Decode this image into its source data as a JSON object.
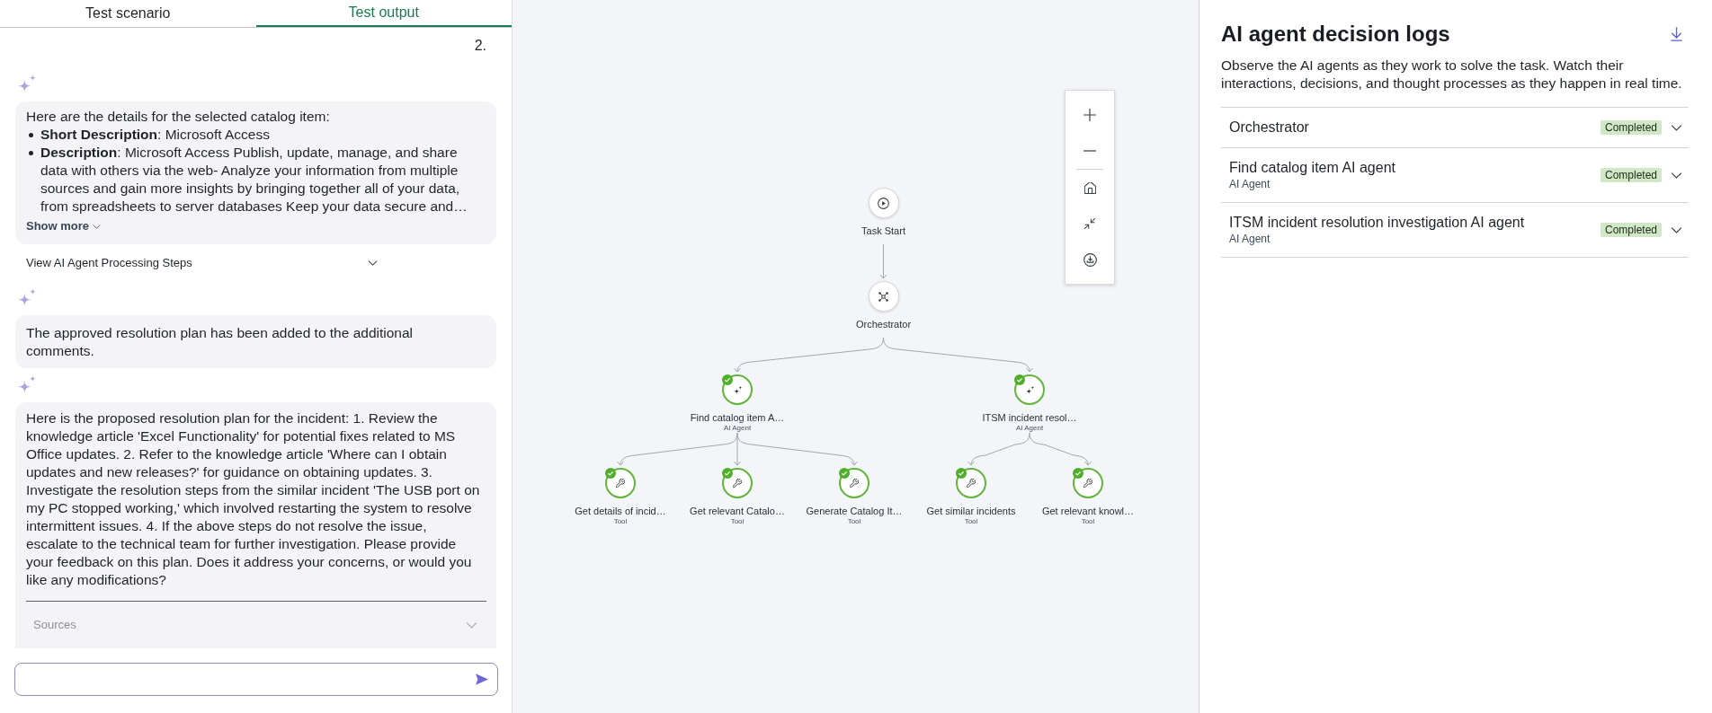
{
  "tabs": [
    {
      "label": "Test scenario",
      "selected": false
    },
    {
      "label": "Test output",
      "selected": true
    }
  ],
  "chat": {
    "partial_message": "2.",
    "messages": [
      {
        "kind": "details",
        "intro": "Here are the details for the selected catalog item:",
        "bullets": [
          "**Short Description**: Microsoft Access",
          "**Description**: Microsoft Access Publish, update, manage, and share data with others via the web- Analyze your information from multiple sources and gain more insights by bringing together all of your data, from spreadsheets to server databases Keep your data secure and…"
        ],
        "show_more": "Show more",
        "steps_toggle": {
          "label": "View AI Agent Processing Steps",
          "expanded": false
        }
      },
      {
        "kind": "text",
        "text": "The approved resolution plan has been added to the additional comments."
      },
      {
        "kind": "text",
        "text": "Here is the proposed resolution plan for the incident: 1. Review the knowledge article 'Excel Functionality' for potential fixes related to MS Office updates. 2. Refer to the knowledge article 'Where can I obtain updates and new releases?' for guidance on obtaining updates. 3. Investigate the resolution steps from the similar incident 'The USB port on my PC stopped working,' which involved restarting the system to resolve intermittent issues. 4. If the above steps do not resolve the issue, escalate to the technical team for further investigation. Please provide your feedback on this plan. Does it address your concerns, or would you like any modifications?",
        "sources": {
          "label": "Sources",
          "expanded": false
        }
      }
    ]
  },
  "flow": {
    "label": "Task Start",
    "kind": "start",
    "completed": false,
    "children": [
      {
        "label": "Orchestrator",
        "kind": "orchestrator",
        "completed": false,
        "children": [
          {
            "label": "Find catalog item A…",
            "type_label": "AI Agent",
            "kind": "agent",
            "completed": true,
            "children": [
              {
                "label": "Get details of incid…",
                "type_label": "Tool",
                "kind": "tool",
                "completed": true
              },
              {
                "label": "Get relevant Catalo…",
                "type_label": "Tool",
                "kind": "tool",
                "completed": true
              },
              {
                "label": "Generate Catalog It…",
                "type_label": "Tool",
                "kind": "tool",
                "completed": true
              }
            ]
          },
          {
            "label": "ITSM incident resol…",
            "type_label": "AI Agent",
            "kind": "agent",
            "completed": true,
            "children": [
              {
                "label": "Get similar incidents",
                "type_label": "Tool",
                "kind": "tool",
                "completed": true
              },
              {
                "label": "Get relevant knowl…",
                "type_label": "Tool",
                "kind": "tool",
                "completed": true
              }
            ]
          }
        ]
      }
    ]
  },
  "decision_logs": {
    "title": "AI agent decision logs",
    "description": "Observe the AI agents as they work to solve the task. Watch their interactions, decisions, and thought processes as they happen in real time.",
    "entries": [
      {
        "title": "Orchestrator",
        "status": "Completed",
        "expanded": false
      },
      {
        "title": "Find catalog item AI agent",
        "subtitle": "AI Agent",
        "status": "Completed",
        "expanded": false
      },
      {
        "title": "ITSM incident resolution investigation AI agent",
        "subtitle": "AI Agent",
        "status": "Completed",
        "expanded": false
      }
    ]
  }
}
